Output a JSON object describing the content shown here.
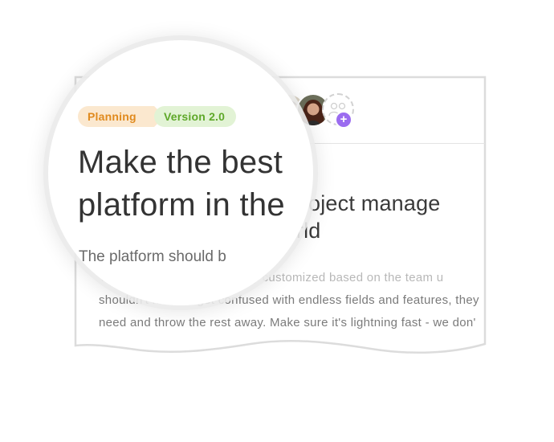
{
  "tags": {
    "status": "Planning",
    "version": "Version 2.0"
  },
  "task": {
    "title_zoomed_line1": "Make the best",
    "title_zoomed_line2": "platform in the",
    "title_card_line1": "mn project manage",
    "title_card_line2": "world",
    "description_zoomed": "The platform should b",
    "description_line1": "Th  uldn't have t      e completely customized based on the team u",
    "description_line2": "shouldn't have to get confused with endless fields and features, they",
    "description_line3": "need and throw the rest away. Make sure it's lightning fast - we don'"
  },
  "members": {
    "add_label": "+"
  },
  "colors": {
    "planning_bg": "#fbe8cf",
    "planning_text": "#e08a1e",
    "version_bg": "#e2f3d5",
    "version_text": "#5ea829",
    "add_button": "#9b6cf0"
  }
}
